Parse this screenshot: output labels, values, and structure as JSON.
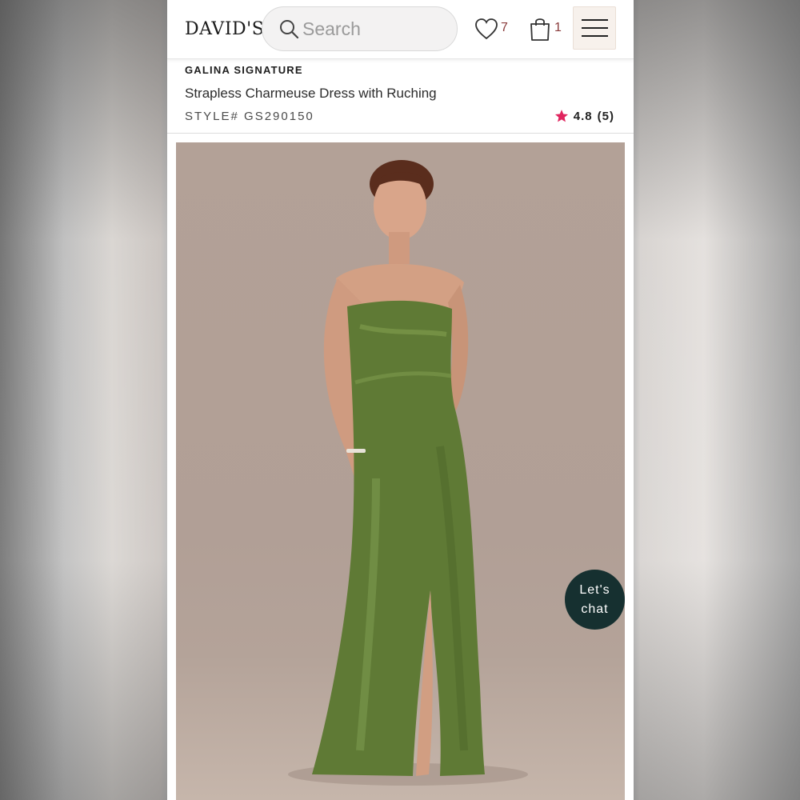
{
  "header": {
    "logo": "DAVID'S",
    "search_placeholder": "Search",
    "wishlist_count": "7",
    "cart_count": "1"
  },
  "product": {
    "brand": "GALINA SIGNATURE",
    "title": "Strapless Charmeuse Dress with Ruching",
    "style_number": "STYLE# GS290150",
    "rating": "4.8",
    "review_count": "(5)"
  },
  "chat": {
    "line1": "Let's",
    "line2": "chat"
  },
  "colors": {
    "accent_star": "#e0245e",
    "chat_bg": "#163030",
    "dress": "#5f7a35"
  },
  "icons": [
    "search-icon",
    "heart-icon",
    "bag-icon",
    "hamburger-menu-icon",
    "star-icon"
  ]
}
